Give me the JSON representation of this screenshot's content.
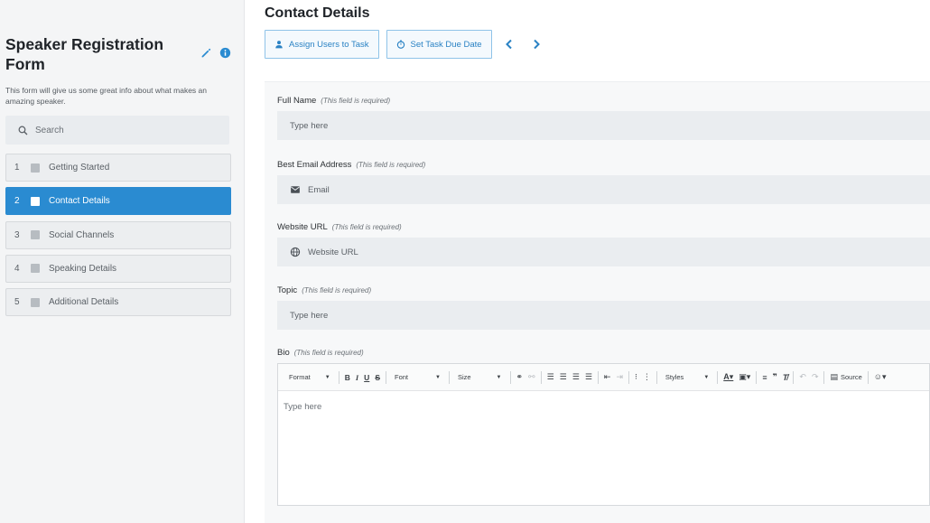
{
  "sidebar": {
    "title": "Speaker Registration Form",
    "description": "This form will give us some great info about what makes an amazing speaker.",
    "search_placeholder": "Search",
    "steps": [
      {
        "num": "1",
        "label": "Getting Started",
        "active": false
      },
      {
        "num": "2",
        "label": "Contact Details",
        "active": true
      },
      {
        "num": "3",
        "label": "Social Channels",
        "active": false
      },
      {
        "num": "4",
        "label": "Speaking Details",
        "active": false
      },
      {
        "num": "5",
        "label": "Additional Details",
        "active": false
      }
    ]
  },
  "main": {
    "title": "Contact Details",
    "toolbar": {
      "assign_label": "Assign Users to Task",
      "due_date_label": "Set Task Due Date"
    },
    "fields": [
      {
        "label": "Full Name",
        "required_note": "(This field is required)",
        "placeholder": "Type here",
        "icon": ""
      },
      {
        "label": "Best Email Address",
        "required_note": "(This field is required)",
        "placeholder": "Email",
        "icon": "envelope-icon"
      },
      {
        "label": "Website URL",
        "required_note": "(This field is required)",
        "placeholder": "Website URL",
        "icon": "globe-icon"
      },
      {
        "label": "Topic",
        "required_note": "(This field is required)",
        "placeholder": "Type here",
        "icon": ""
      }
    ],
    "bio": {
      "label": "Bio",
      "required_note": "(This field is required)",
      "placeholder": "Type here",
      "toolbar": {
        "format": "Format",
        "font": "Font",
        "size": "Size",
        "styles": "Styles",
        "source": "Source"
      }
    }
  },
  "colors": {
    "accent": "#2a8bd1",
    "button_text": "#2a82c4"
  }
}
